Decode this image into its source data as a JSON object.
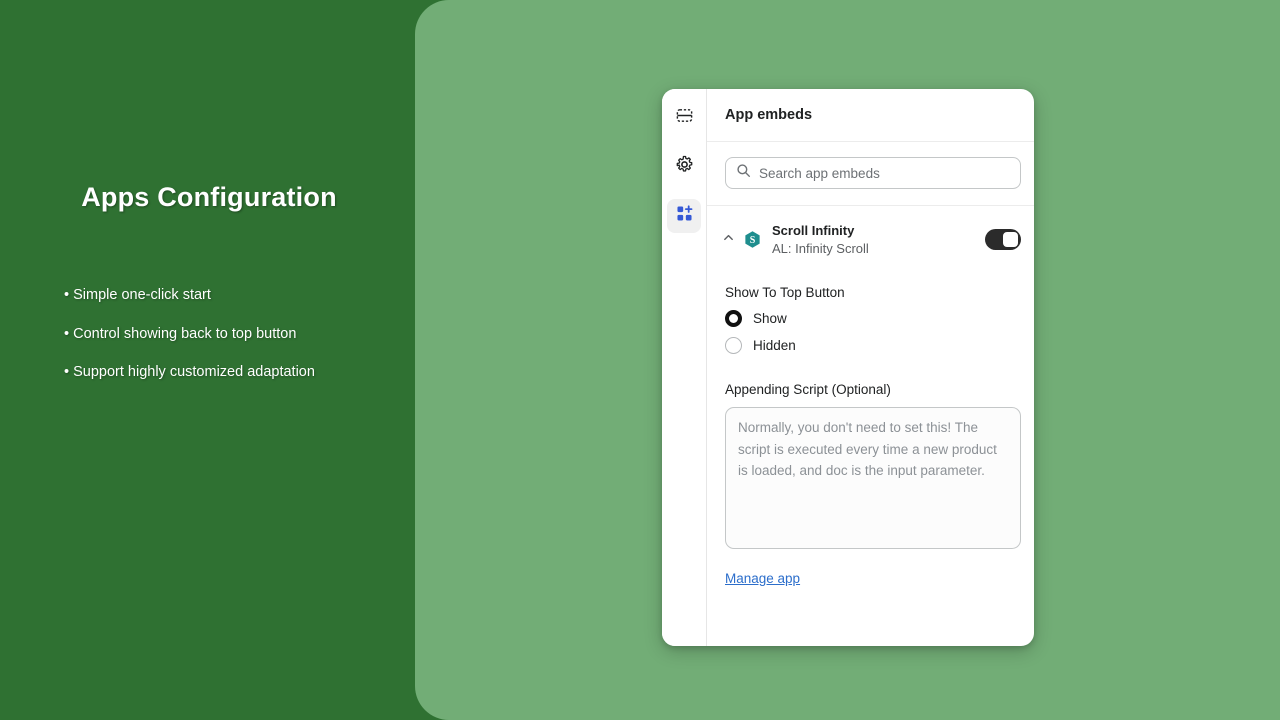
{
  "slide": {
    "title": "Apps Configuration",
    "bullets": [
      "• Simple one-click start",
      "• Control showing back to top button",
      "• Support highly customized adaptation"
    ],
    "colors": {
      "left_bg": "#2f7132",
      "right_bg": "#72ad76",
      "card_bg": "#ffffff"
    }
  },
  "card": {
    "header": {
      "title": "App embeds"
    },
    "rail": {
      "items": [
        {
          "icon": "sections-icon",
          "active": false
        },
        {
          "icon": "gear-icon",
          "active": false
        },
        {
          "icon": "apps-add-icon",
          "active": true
        }
      ]
    },
    "search": {
      "icon": "search-icon",
      "placeholder": "Search app embeds",
      "value": ""
    },
    "app": {
      "collapse_icon": "chevron-up-icon",
      "logo_letter": "S",
      "logo_color": "#1f8e8e",
      "name": "Scroll Infinity",
      "subtitle": "AL: Infinity Scroll",
      "toggle": {
        "state": "on",
        "color": "#2b2b2b"
      }
    },
    "settings": {
      "show_to_top_label": "Show To Top Button",
      "radios": [
        {
          "label": "Show",
          "selected": true
        },
        {
          "label": "Hidden",
          "selected": false
        }
      ],
      "script_label": "Appending Script (Optional)",
      "script_placeholder": "Normally, you don't need to set this! The script is executed every time a new product is loaded, and doc is the input parameter.",
      "script_value": ""
    },
    "manage_link": {
      "label": "Manage app",
      "color": "#2c6ecb"
    }
  }
}
